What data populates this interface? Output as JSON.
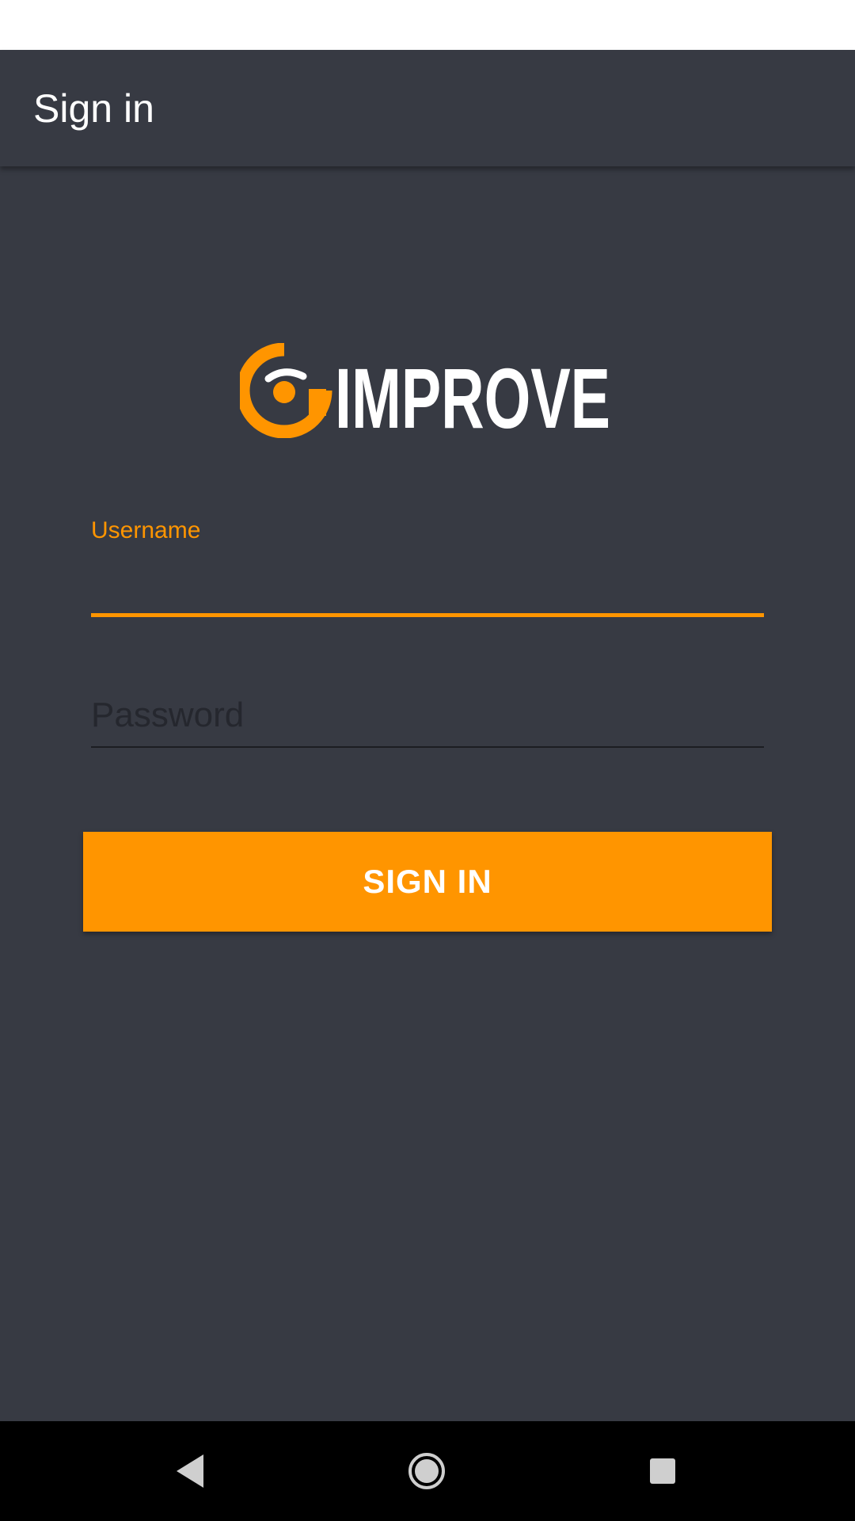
{
  "app_bar": {
    "title": "Sign in"
  },
  "logo": {
    "text": "IMPROVE",
    "accent_color": "#ff9500",
    "text_color": "#ffffff"
  },
  "form": {
    "username": {
      "label": "Username",
      "value": ""
    },
    "password": {
      "placeholder": "Password",
      "value": ""
    },
    "submit_label": "SIGN IN"
  },
  "nav_bar": {
    "icons": [
      "back-icon",
      "home-icon",
      "recents-icon"
    ]
  },
  "colors": {
    "background": "#373a43",
    "accent": "#ff9500",
    "status_bar": "#ffffff",
    "nav_bar": "#000000"
  }
}
